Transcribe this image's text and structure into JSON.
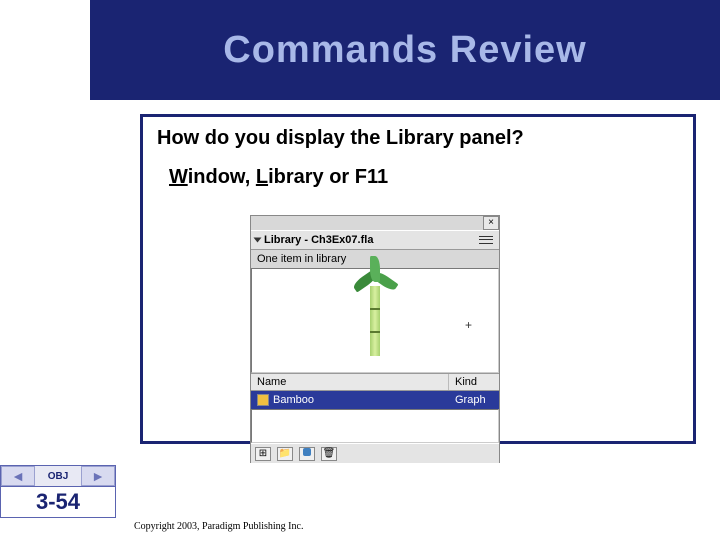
{
  "title": "Commands Review",
  "question": "How do you display the Library panel?",
  "answer_pre1": "W",
  "answer_seg1": "indow, ",
  "answer_pre2": "L",
  "answer_seg2": "ibrary or F11",
  "panel": {
    "title": "Library - Ch3Ex07.fla",
    "status": "One item in library",
    "headers": {
      "name": "Name",
      "kind": "Kind"
    },
    "row": {
      "name": "Bamboo",
      "kind": "Graph"
    }
  },
  "nav": {
    "obj_label": "OBJ",
    "page": "3-54"
  },
  "copyright": "Copyright 2003, Paradigm Publishing Inc."
}
